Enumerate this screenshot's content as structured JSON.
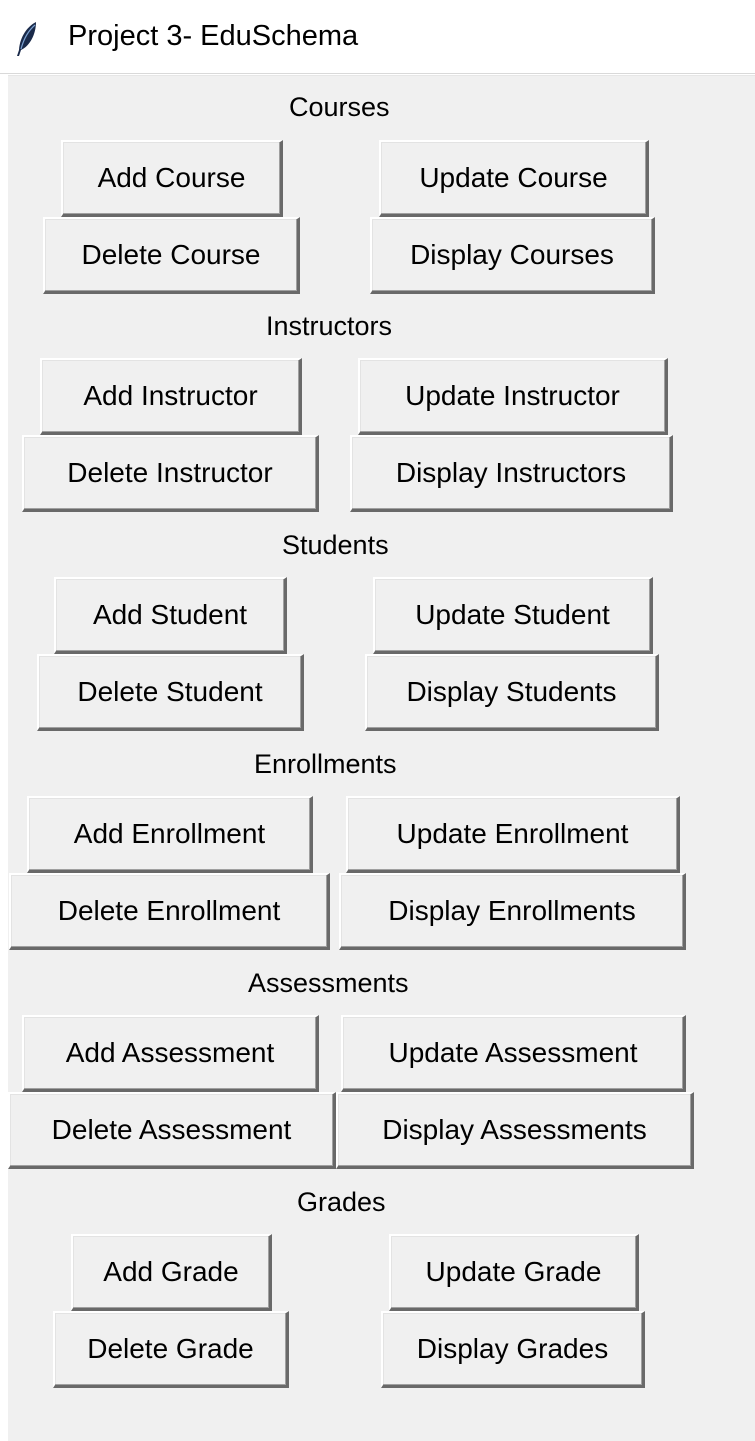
{
  "window": {
    "title": "Project 3- EduSchema",
    "icon": "feather-icon"
  },
  "sections": {
    "courses": {
      "heading": "Courses",
      "add": "Add Course",
      "update": "Update Course",
      "delete": "Delete Course",
      "display": "Display Courses"
    },
    "instructors": {
      "heading": "Instructors",
      "add": "Add Instructor",
      "update": "Update Instructor",
      "delete": "Delete Instructor",
      "display": "Display Instructors"
    },
    "students": {
      "heading": "Students",
      "add": "Add Student",
      "update": "Update Student",
      "delete": "Delete Student",
      "display": "Display Students"
    },
    "enrollments": {
      "heading": "Enrollments",
      "add": "Add Enrollment",
      "update": "Update Enrollment",
      "delete": "Delete Enrollment",
      "display": "Display Enrollments"
    },
    "assessments": {
      "heading": "Assessments",
      "add": "Add Assessment",
      "update": "Update Assessment",
      "delete": "Delete Assessment",
      "display": "Display Assessments"
    },
    "grades": {
      "heading": "Grades",
      "add": "Add Grade",
      "update": "Update Grade",
      "delete": "Delete Grade",
      "display": "Display Grades"
    }
  }
}
